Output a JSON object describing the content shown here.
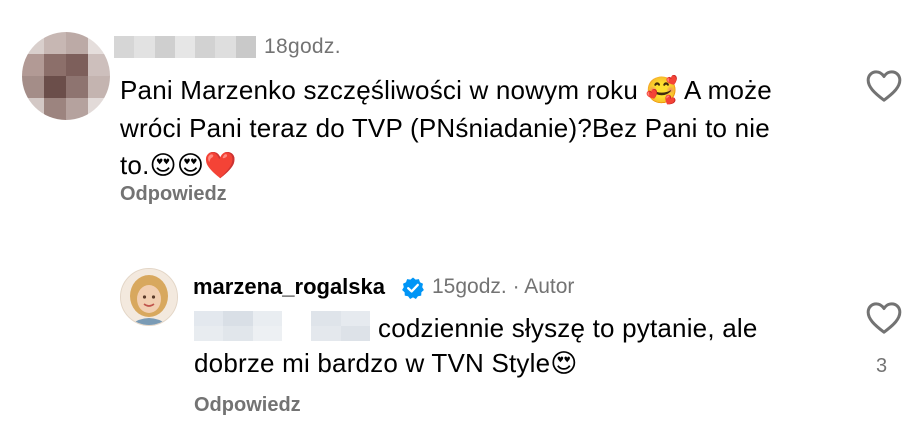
{
  "comments": [
    {
      "time": "18godz.",
      "text": "Pani Marzenko szczęśliwości w nowym roku ",
      "emoji_1": "🥰",
      "text_2": " A może",
      "text_line2": "wróci Pani teraz do TVP (PNśniadanie)?Bez Pani to nie",
      "text_line3": "to.",
      "emoji_tail": "😍😍❤️",
      "reply_label": "Odpowiedz",
      "like_icon": "heart-outline-icon"
    },
    {
      "username": "marzena_rogalska",
      "verified_icon": "verified-badge-icon",
      "meta": "15godz. · Autor",
      "text_line1": "codziennie słyszę to pytanie, ale",
      "text_line2": "dobrze mi bardzo w TVN Style",
      "emoji_tail": "😍",
      "reply_label": "Odpowiedz",
      "like_icon": "heart-outline-icon",
      "like_count": "3"
    }
  ],
  "colors": {
    "secondary_text": "#737373",
    "verified_blue": "#0095f6"
  }
}
